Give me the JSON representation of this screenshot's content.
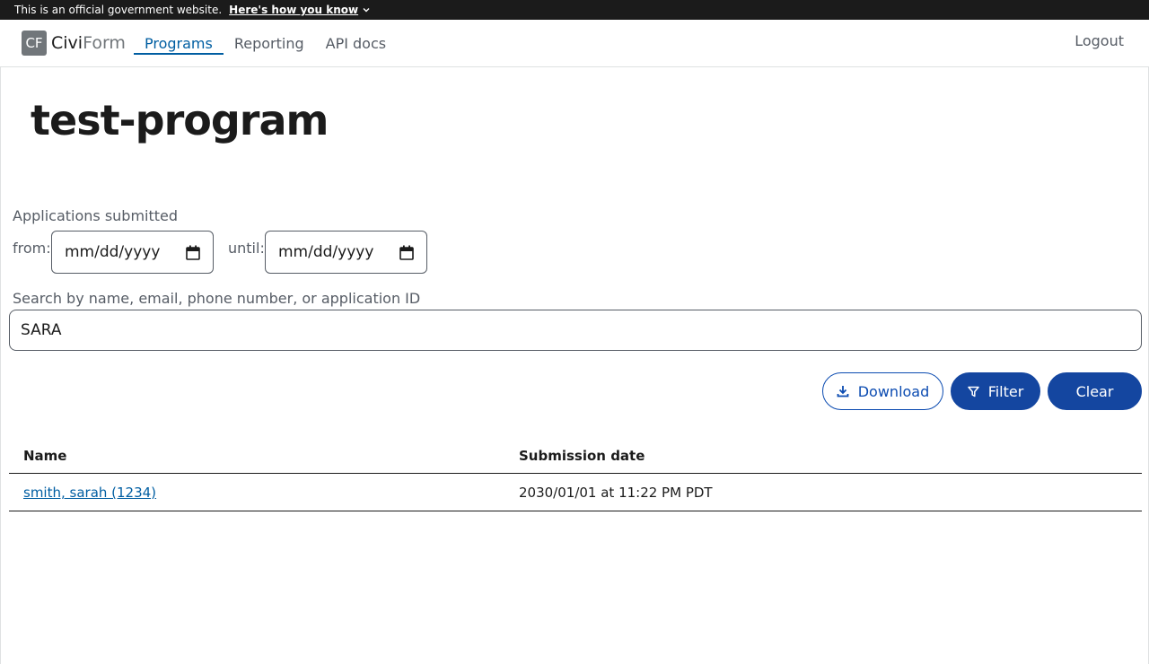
{
  "gov_banner": {
    "text": "This is an official government website.",
    "link": "Here's how you know"
  },
  "header": {
    "brand_badge": "CF",
    "brand_civi": "Civi",
    "brand_form": "Form",
    "nav": [
      {
        "label": "Programs",
        "active": true
      },
      {
        "label": "Reporting",
        "active": false
      },
      {
        "label": "API docs",
        "active": false
      }
    ],
    "logout": "Logout"
  },
  "page": {
    "title": "test-program"
  },
  "filters": {
    "applications_label": "Applications submitted",
    "from_label": "from:",
    "until_label": "until:",
    "from_value": "mm/dd/yyyy",
    "until_value": "mm/dd/yyyy",
    "search_label": "Search by name, email, phone number, or application ID",
    "search_value": "SARA"
  },
  "actions": {
    "download": "Download",
    "filter": "Filter",
    "clear": "Clear"
  },
  "table": {
    "columns": [
      "Name",
      "Submission date"
    ],
    "rows": [
      {
        "name": "smith, sarah (1234)",
        "date": "2030/01/01 at 11:22 PM PDT"
      }
    ]
  },
  "icons": {
    "calendar": "calendar-icon",
    "download": "download-icon",
    "filter": "filter-icon",
    "chevron": "chevron-down-icon"
  },
  "colors": {
    "primary": "#1446a0",
    "link": "#005ea2",
    "banner_bg": "#1b1b1b"
  }
}
